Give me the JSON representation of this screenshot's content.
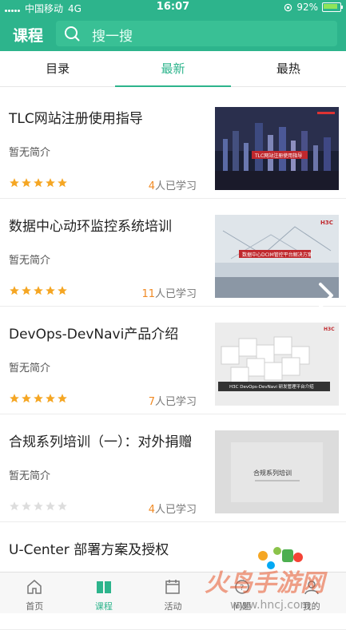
{
  "status_bar": {
    "carrier": "中国移动",
    "network": "4G",
    "time": "16:07",
    "battery": "92%"
  },
  "header": {
    "title": "课程",
    "search_placeholder": "搜一搜"
  },
  "tabs": [
    {
      "label": "目录",
      "active": false
    },
    {
      "label": "最新",
      "active": true
    },
    {
      "label": "最热",
      "active": false
    }
  ],
  "courses": [
    {
      "title": "TLC网站注册使用指导",
      "desc": "暂无简介",
      "rating": 5,
      "learners": "4",
      "learners_suffix": "人已学习",
      "thumb_text": "TLC网站注册使用指导"
    },
    {
      "title": "数据中心动环监控系统培训",
      "desc": "暂无简介",
      "rating": 5,
      "learners": "11",
      "learners_suffix": "人已学习",
      "thumb_text": "数据中心DCIM管控平台解决方案"
    },
    {
      "title": "DevOps-DevNavi产品介绍",
      "desc": "暂无简介",
      "rating": 5,
      "learners": "7",
      "learners_suffix": "人已学习",
      "thumb_text": "H3C DevOps-DevNavi 研发管理平台介绍"
    },
    {
      "title": "合规系列培训（一）：对外捐赠",
      "desc": "暂无简介",
      "rating": 0,
      "learners": "4",
      "learners_suffix": "人已学习",
      "thumb_text": "合规系列培训"
    },
    {
      "title": "U-Center 部署方案及授权",
      "desc": "",
      "rating": 0,
      "learners": "",
      "learners_suffix": "",
      "thumb_text": ""
    }
  ],
  "nav": [
    {
      "label": "首页",
      "icon": "home-icon",
      "active": false
    },
    {
      "label": "课程",
      "icon": "book-icon",
      "active": true
    },
    {
      "label": "活动",
      "icon": "calendar-icon",
      "active": false
    },
    {
      "label": "问题",
      "icon": "question-icon",
      "active": false
    },
    {
      "label": "我的",
      "icon": "user-icon",
      "active": false
    }
  ],
  "watermark_text": "火鸟手游网 www.hncj.com",
  "colors": {
    "brand": "#2db48c",
    "star": "#f5a623",
    "star_empty": "#dddddd",
    "count": "#f08a24"
  }
}
